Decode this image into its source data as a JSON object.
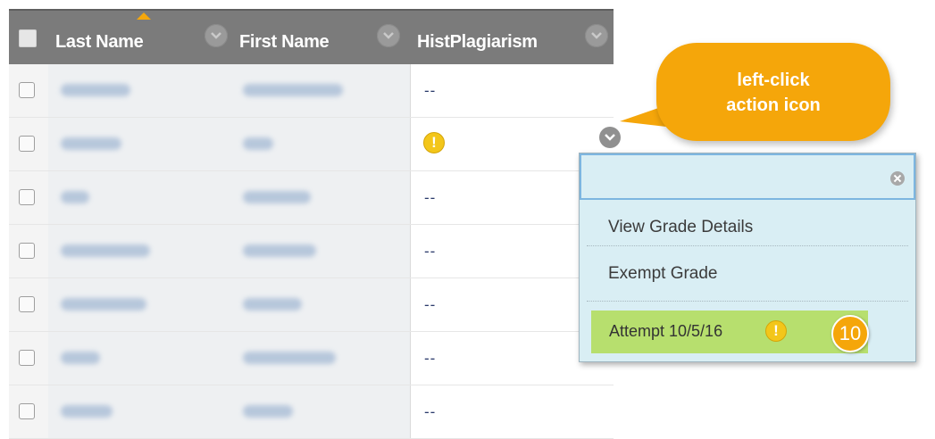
{
  "grid": {
    "columns": {
      "last_name": "Last Name",
      "first_name": "First Name",
      "assignment": "HistPlagiarism"
    },
    "rows": [
      {
        "grade": "--"
      },
      {
        "grade": "!",
        "needs_grading": true
      },
      {
        "grade": "--"
      },
      {
        "grade": "--"
      },
      {
        "grade": "--"
      },
      {
        "grade": "--"
      },
      {
        "grade": "--"
      }
    ]
  },
  "callout": {
    "line1": "left-click",
    "line2": "action icon"
  },
  "context_menu": {
    "items": [
      "View Grade Details",
      "Exempt Grade"
    ],
    "attempt_label": "Attempt 10/5/16",
    "attempt_icon": "!",
    "step_badge": "10"
  },
  "colors": {
    "header_bg": "#7b7b7b",
    "callout": "#f5a60a",
    "menu_bg": "#d9eef4",
    "attempt_highlight": "#b7df6e",
    "needs_grading": "#f3c61a"
  },
  "icons": [
    "sort-ascending-icon",
    "column-menu-icon",
    "needs-grading-icon",
    "action-menu-icon",
    "close-icon"
  ]
}
